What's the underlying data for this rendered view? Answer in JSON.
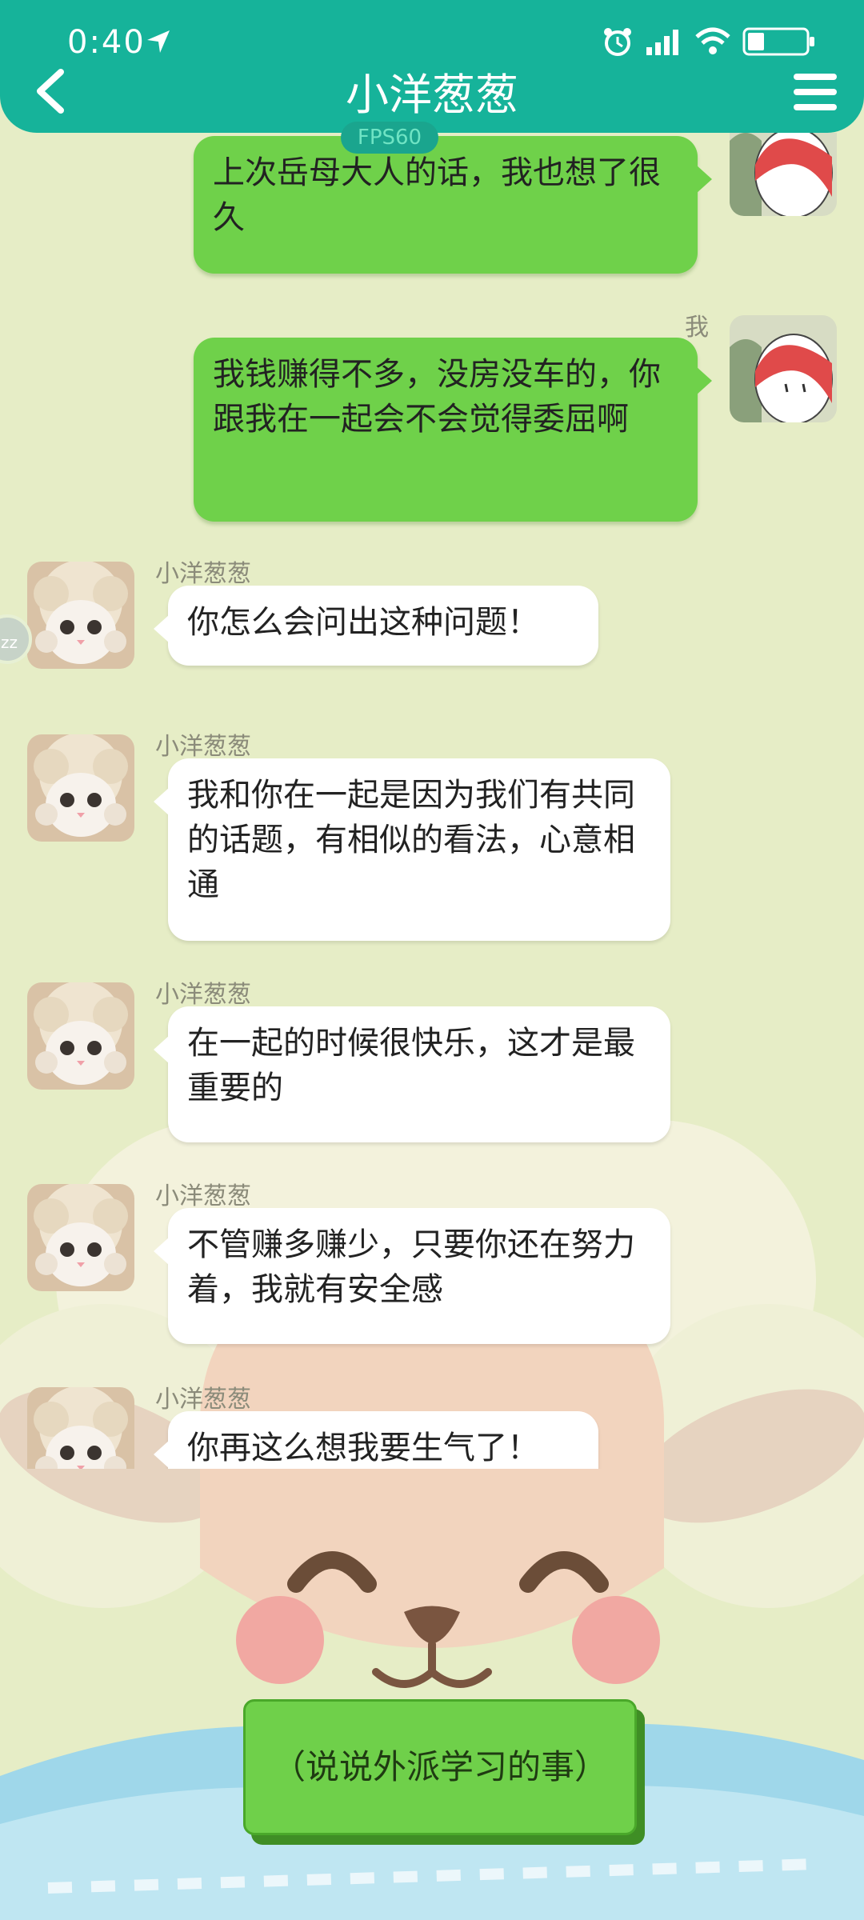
{
  "status_bar": {
    "time": "0:40"
  },
  "header": {
    "title": "小洋葱葱",
    "fps": "FPS60"
  },
  "side_handle": {
    "label": "zz"
  },
  "messages": [
    {
      "from": "me",
      "sender": "",
      "text": "上次岳母大人的话，我也想了很久"
    },
    {
      "from": "me",
      "sender": "我",
      "text": "我钱赚得不多，没房没车的，你跟我在一起会不会觉得委屈啊"
    },
    {
      "from": "other",
      "sender": "小洋葱葱",
      "text": "你怎么会问出这种问题！"
    },
    {
      "from": "other",
      "sender": "小洋葱葱",
      "text": "我和你在一起是因为我们有共同的话题，有相似的看法，心意相通"
    },
    {
      "from": "other",
      "sender": "小洋葱葱",
      "text": "在一起的时候很快乐，这才是最重要的"
    },
    {
      "from": "other",
      "sender": "小洋葱葱",
      "text": "不管赚多赚少，只要你还在努力着，我就有安全感"
    },
    {
      "from": "other",
      "sender": "小洋葱葱",
      "text": "你再这么想我要生气了！"
    }
  ],
  "choice": {
    "label": "（说说外派学习的事）"
  },
  "colors": {
    "header": "#16b39a",
    "bubble_me": "#6fd14a",
    "bubble_other": "#ffffff",
    "background": "#e6edc6"
  }
}
